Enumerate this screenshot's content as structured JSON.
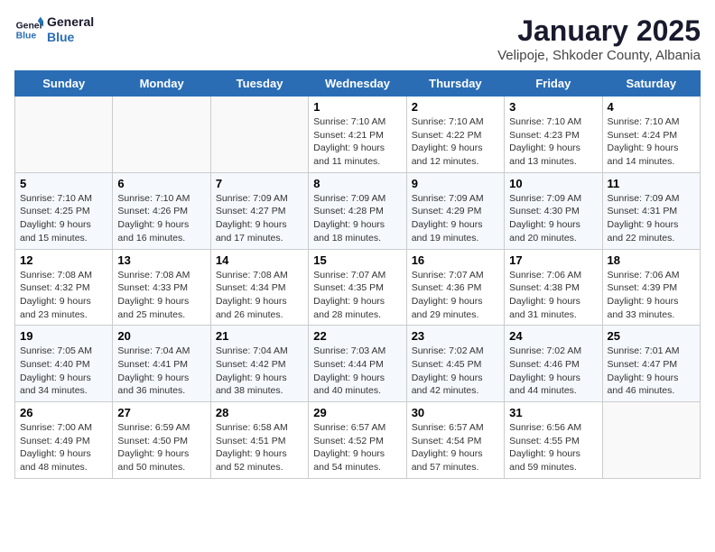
{
  "logo": {
    "text_general": "General",
    "text_blue": "Blue"
  },
  "title": "January 2025",
  "subtitle": "Velipoje, Shkoder County, Albania",
  "weekdays": [
    "Sunday",
    "Monday",
    "Tuesday",
    "Wednesday",
    "Thursday",
    "Friday",
    "Saturday"
  ],
  "weeks": [
    [
      {
        "day": "",
        "sunrise": "",
        "sunset": "",
        "daylight": ""
      },
      {
        "day": "",
        "sunrise": "",
        "sunset": "",
        "daylight": ""
      },
      {
        "day": "",
        "sunrise": "",
        "sunset": "",
        "daylight": ""
      },
      {
        "day": "1",
        "sunrise": "Sunrise: 7:10 AM",
        "sunset": "Sunset: 4:21 PM",
        "daylight": "Daylight: 9 hours and 11 minutes."
      },
      {
        "day": "2",
        "sunrise": "Sunrise: 7:10 AM",
        "sunset": "Sunset: 4:22 PM",
        "daylight": "Daylight: 9 hours and 12 minutes."
      },
      {
        "day": "3",
        "sunrise": "Sunrise: 7:10 AM",
        "sunset": "Sunset: 4:23 PM",
        "daylight": "Daylight: 9 hours and 13 minutes."
      },
      {
        "day": "4",
        "sunrise": "Sunrise: 7:10 AM",
        "sunset": "Sunset: 4:24 PM",
        "daylight": "Daylight: 9 hours and 14 minutes."
      }
    ],
    [
      {
        "day": "5",
        "sunrise": "Sunrise: 7:10 AM",
        "sunset": "Sunset: 4:25 PM",
        "daylight": "Daylight: 9 hours and 15 minutes."
      },
      {
        "day": "6",
        "sunrise": "Sunrise: 7:10 AM",
        "sunset": "Sunset: 4:26 PM",
        "daylight": "Daylight: 9 hours and 16 minutes."
      },
      {
        "day": "7",
        "sunrise": "Sunrise: 7:09 AM",
        "sunset": "Sunset: 4:27 PM",
        "daylight": "Daylight: 9 hours and 17 minutes."
      },
      {
        "day": "8",
        "sunrise": "Sunrise: 7:09 AM",
        "sunset": "Sunset: 4:28 PM",
        "daylight": "Daylight: 9 hours and 18 minutes."
      },
      {
        "day": "9",
        "sunrise": "Sunrise: 7:09 AM",
        "sunset": "Sunset: 4:29 PM",
        "daylight": "Daylight: 9 hours and 19 minutes."
      },
      {
        "day": "10",
        "sunrise": "Sunrise: 7:09 AM",
        "sunset": "Sunset: 4:30 PM",
        "daylight": "Daylight: 9 hours and 20 minutes."
      },
      {
        "day": "11",
        "sunrise": "Sunrise: 7:09 AM",
        "sunset": "Sunset: 4:31 PM",
        "daylight": "Daylight: 9 hours and 22 minutes."
      }
    ],
    [
      {
        "day": "12",
        "sunrise": "Sunrise: 7:08 AM",
        "sunset": "Sunset: 4:32 PM",
        "daylight": "Daylight: 9 hours and 23 minutes."
      },
      {
        "day": "13",
        "sunrise": "Sunrise: 7:08 AM",
        "sunset": "Sunset: 4:33 PM",
        "daylight": "Daylight: 9 hours and 25 minutes."
      },
      {
        "day": "14",
        "sunrise": "Sunrise: 7:08 AM",
        "sunset": "Sunset: 4:34 PM",
        "daylight": "Daylight: 9 hours and 26 minutes."
      },
      {
        "day": "15",
        "sunrise": "Sunrise: 7:07 AM",
        "sunset": "Sunset: 4:35 PM",
        "daylight": "Daylight: 9 hours and 28 minutes."
      },
      {
        "day": "16",
        "sunrise": "Sunrise: 7:07 AM",
        "sunset": "Sunset: 4:36 PM",
        "daylight": "Daylight: 9 hours and 29 minutes."
      },
      {
        "day": "17",
        "sunrise": "Sunrise: 7:06 AM",
        "sunset": "Sunset: 4:38 PM",
        "daylight": "Daylight: 9 hours and 31 minutes."
      },
      {
        "day": "18",
        "sunrise": "Sunrise: 7:06 AM",
        "sunset": "Sunset: 4:39 PM",
        "daylight": "Daylight: 9 hours and 33 minutes."
      }
    ],
    [
      {
        "day": "19",
        "sunrise": "Sunrise: 7:05 AM",
        "sunset": "Sunset: 4:40 PM",
        "daylight": "Daylight: 9 hours and 34 minutes."
      },
      {
        "day": "20",
        "sunrise": "Sunrise: 7:04 AM",
        "sunset": "Sunset: 4:41 PM",
        "daylight": "Daylight: 9 hours and 36 minutes."
      },
      {
        "day": "21",
        "sunrise": "Sunrise: 7:04 AM",
        "sunset": "Sunset: 4:42 PM",
        "daylight": "Daylight: 9 hours and 38 minutes."
      },
      {
        "day": "22",
        "sunrise": "Sunrise: 7:03 AM",
        "sunset": "Sunset: 4:44 PM",
        "daylight": "Daylight: 9 hours and 40 minutes."
      },
      {
        "day": "23",
        "sunrise": "Sunrise: 7:02 AM",
        "sunset": "Sunset: 4:45 PM",
        "daylight": "Daylight: 9 hours and 42 minutes."
      },
      {
        "day": "24",
        "sunrise": "Sunrise: 7:02 AM",
        "sunset": "Sunset: 4:46 PM",
        "daylight": "Daylight: 9 hours and 44 minutes."
      },
      {
        "day": "25",
        "sunrise": "Sunrise: 7:01 AM",
        "sunset": "Sunset: 4:47 PM",
        "daylight": "Daylight: 9 hours and 46 minutes."
      }
    ],
    [
      {
        "day": "26",
        "sunrise": "Sunrise: 7:00 AM",
        "sunset": "Sunset: 4:49 PM",
        "daylight": "Daylight: 9 hours and 48 minutes."
      },
      {
        "day": "27",
        "sunrise": "Sunrise: 6:59 AM",
        "sunset": "Sunset: 4:50 PM",
        "daylight": "Daylight: 9 hours and 50 minutes."
      },
      {
        "day": "28",
        "sunrise": "Sunrise: 6:58 AM",
        "sunset": "Sunset: 4:51 PM",
        "daylight": "Daylight: 9 hours and 52 minutes."
      },
      {
        "day": "29",
        "sunrise": "Sunrise: 6:57 AM",
        "sunset": "Sunset: 4:52 PM",
        "daylight": "Daylight: 9 hours and 54 minutes."
      },
      {
        "day": "30",
        "sunrise": "Sunrise: 6:57 AM",
        "sunset": "Sunset: 4:54 PM",
        "daylight": "Daylight: 9 hours and 57 minutes."
      },
      {
        "day": "31",
        "sunrise": "Sunrise: 6:56 AM",
        "sunset": "Sunset: 4:55 PM",
        "daylight": "Daylight: 9 hours and 59 minutes."
      },
      {
        "day": "",
        "sunrise": "",
        "sunset": "",
        "daylight": ""
      }
    ]
  ]
}
